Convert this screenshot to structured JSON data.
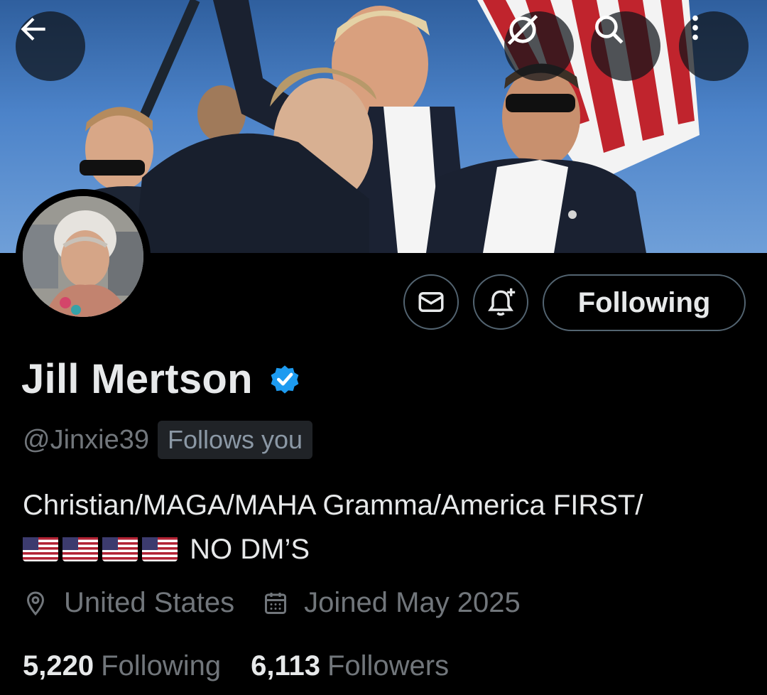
{
  "header": {
    "back_icon": "arrow-left-icon",
    "grok_icon": "grok-icon",
    "search_icon": "search-icon",
    "more_icon": "more-vertical-icon"
  },
  "actions": {
    "message_icon": "envelope-icon",
    "notify_icon": "bell-plus-icon",
    "following_label": "Following"
  },
  "profile": {
    "display_name": "Jill Mertson",
    "verified_icon": "verified-badge-icon",
    "verified_color": "#1d9bf0",
    "handle": "@Jinxie39",
    "follows_you": "Follows you",
    "bio_line1": "Christian/MAGA/MAHA Gramma/America FIRST/",
    "bio_flags": [
      "us-flag-emoji",
      "us-flag-emoji",
      "us-flag-emoji",
      "us-flag-emoji"
    ],
    "bio_line2_text": "NO DM’S",
    "location": "United States",
    "joined": "Joined May 2025",
    "following_count": "5,220",
    "following_label": "Following",
    "followers_count": "6,113",
    "followers_label": "Followers"
  },
  "colors": {
    "background": "#000000",
    "primary_text": "#e7e9ea",
    "secondary_text": "#71767b",
    "border": "#536471"
  }
}
